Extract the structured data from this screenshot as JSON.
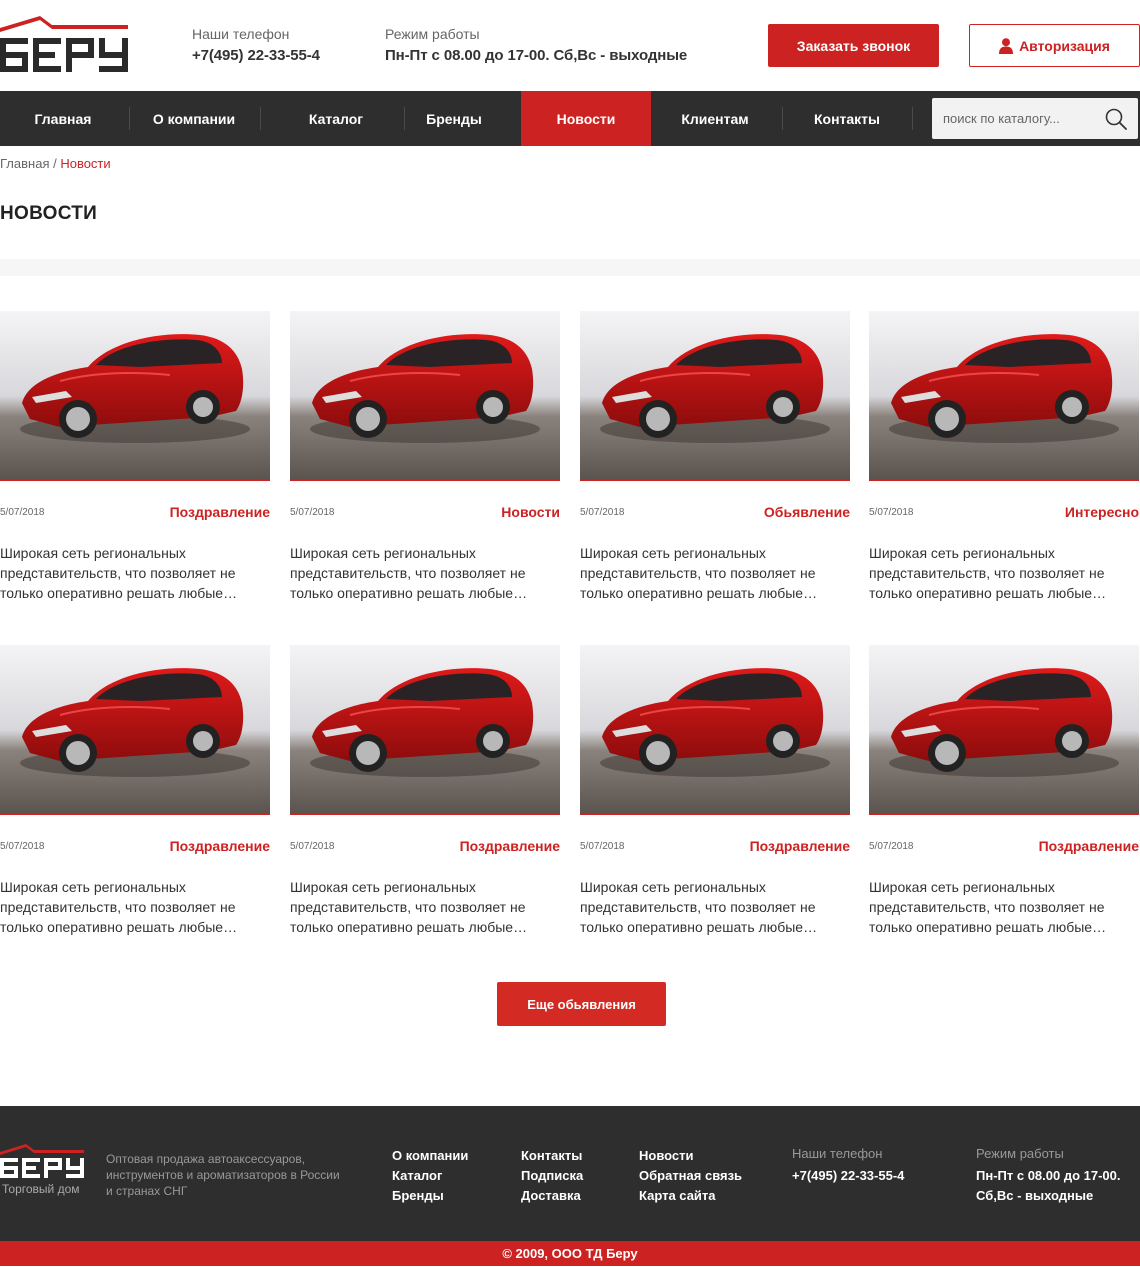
{
  "brand": {
    "name": "Беру",
    "tagline": "Торговый дом",
    "accent": "#cc2222",
    "dark": "#2e2e2e"
  },
  "header": {
    "phone_label": "Наши телефон",
    "phone": "+7(495) 22-33-55-4",
    "hours_label": "Режим работы",
    "hours": "Пн-Пт с 08.00 до 17-00. Сб,Вс - выходные",
    "call_button": "Заказать звонок",
    "auth_button": "Авторизация",
    "auth_icon": "user-icon"
  },
  "nav": {
    "items": [
      {
        "label": "Главная",
        "active": false
      },
      {
        "label": "О компании",
        "active": false
      },
      {
        "label": "Каталог",
        "active": false
      },
      {
        "label": "Бренды",
        "active": false
      },
      {
        "label": "Новости",
        "active": true
      },
      {
        "label": "Клиентам",
        "active": false
      },
      {
        "label": "Контакты",
        "active": false
      }
    ],
    "search_placeholder": "поиск по каталогу...",
    "search_icon": "search-icon"
  },
  "breadcrumb": {
    "home": "Главная",
    "separator": " / ",
    "current": "Новости"
  },
  "page_title": "НОВОСТИ",
  "news": [
    {
      "date": "5/07/2018",
      "category": "Поздравление",
      "text": "Широкая сеть региональных представительств, что позволяет не только оперативно решать любые…"
    },
    {
      "date": "5/07/2018",
      "category": "Новости",
      "text": "Широкая сеть региональных представительств, что позволяет не только оперативно решать любые…"
    },
    {
      "date": "5/07/2018",
      "category": "Обьявление",
      "text": "Широкая сеть региональных представительств, что позволяет не только оперативно решать любые…"
    },
    {
      "date": "5/07/2018",
      "category": "Интересно",
      "text": "Широкая сеть региональных представительств, что позволяет не только оперативно решать любые…"
    },
    {
      "date": "5/07/2018",
      "category": "Поздравление",
      "text": "Широкая сеть региональных представительств, что позволяет не только оперативно решать любые…"
    },
    {
      "date": "5/07/2018",
      "category": "Поздравление",
      "text": "Широкая сеть региональных представительств, что позволяет не только оперативно решать любые…"
    },
    {
      "date": "5/07/2018",
      "category": "Поздравление",
      "text": "Широкая сеть региональных представительств, что позволяет не только оперативно решать любые…"
    },
    {
      "date": "5/07/2018",
      "category": "Поздравление",
      "text": "Широкая сеть региональных представительств, что позволяет не только оперативно решать любые…"
    }
  ],
  "more_button": "Еще обьявления",
  "footer": {
    "description": "Оптовая продажа автоаксессуаров, инструментов и ароматизаторов в России и странах СНГ",
    "col1": [
      "О компании",
      "Каталог",
      "Бренды"
    ],
    "col2": [
      "Контакты",
      "Подписка",
      "Доставка"
    ],
    "col3": [
      "Новости",
      "Обратная связь",
      "Карта сайта"
    ],
    "phone_label": "Наши телефон",
    "phone": "+7(495) 22-33-55-4",
    "hours_label": "Режим работы",
    "hours_line1": "Пн-Пт с 08.00 до 17-00.",
    "hours_line2": "Сб,Вс - выходные",
    "copyright": "© 2009, ООО ТД Беру"
  }
}
